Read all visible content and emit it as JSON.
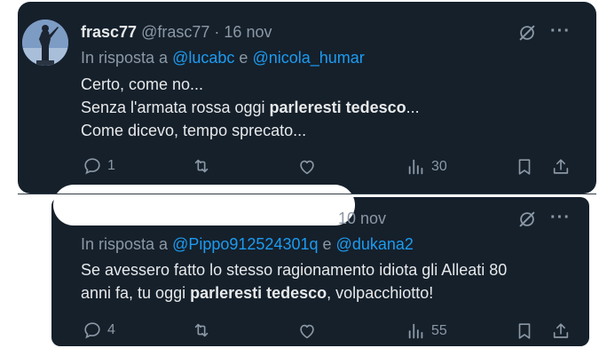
{
  "tweets": [
    {
      "display_name": "frasc77",
      "handle": "@frasc77",
      "sep": "·",
      "date": "16 nov",
      "reply_prefix": "In risposta a",
      "reply_to_1": "@lucabc",
      "reply_join": "e",
      "reply_to_2": "@nicola_humar",
      "body_line_1": "Certo, come no...",
      "body_line_2_pre": "Senza l'armata rossa oggi ",
      "body_line_2_bold": "parleresti tedesco",
      "body_line_2_post": "...",
      "body_line_3": "Come dicevo, tempo sprecato...",
      "replies": "1",
      "reposts": "",
      "likes": "",
      "views": "30"
    },
    {
      "date": "10 nov",
      "reply_prefix": "In risposta a",
      "reply_to_1": "@Pippo912524301q",
      "reply_join": "e",
      "reply_to_2": "@dukana2",
      "body_line_1": "Se avessero fatto lo stesso ragionamento idiota gli Alleati 80",
      "body_line_2_pre": "anni fa, tu oggi ",
      "body_line_2_bold": "parleresti tedesco",
      "body_line_2_post": ", volpacchiotto!",
      "replies": "4",
      "reposts": "",
      "likes": "",
      "views": "55"
    }
  ],
  "more_label": "···",
  "colors": {
    "background": "#15202b",
    "text": "#e7e9ea",
    "muted": "#8b98a5",
    "link": "#1d9bf0"
  }
}
